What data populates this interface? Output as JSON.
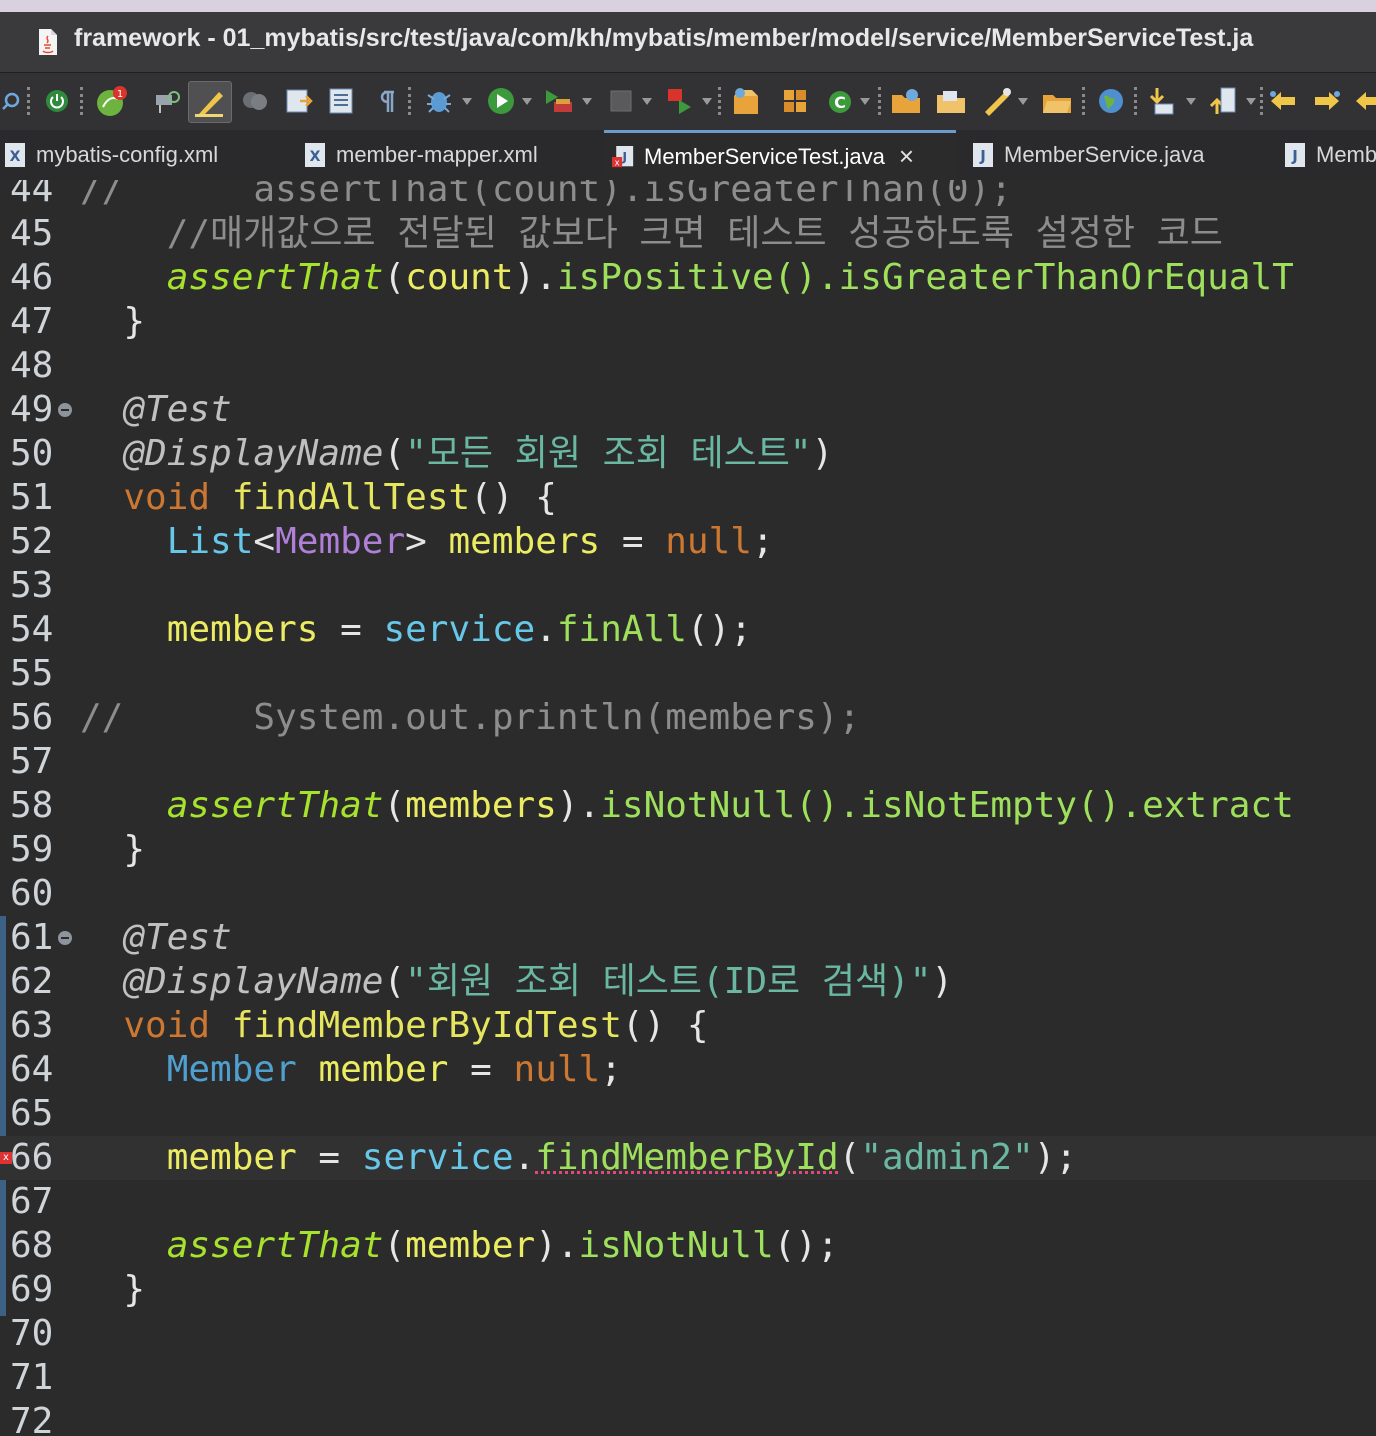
{
  "window": {
    "title": "framework - 01_mybatis/src/test/java/com/kh/mybatis/member/model/service/MemberServiceTest.ja"
  },
  "toolbar": {
    "items": [
      "search-icon",
      "debug-skip-icon",
      "power-icon",
      "spring-icon",
      "pin-icon",
      "highlight-icon",
      "terminal-icon",
      "open-task-icon",
      "open-console-icon",
      "pilcrow-icon",
      "debug-icon",
      "run-icon",
      "coverage-icon",
      "stop-icon",
      "external-tool-icon",
      "new-package-icon",
      "new-class-icon",
      "new-refresh-icon",
      "open-folder-icon",
      "open-project-icon",
      "brush-icon",
      "open-file-icon",
      "globe-icon",
      "next-annotation-icon",
      "prev-annotation-icon",
      "back-icon",
      "forward-icon",
      "back-alt-icon"
    ],
    "spring_badge": "1"
  },
  "tabs": [
    {
      "label": "mybatis-config.xml",
      "icon": "xml-file-icon",
      "active": false
    },
    {
      "label": "member-mapper.xml",
      "icon": "xml-file-icon",
      "active": false
    },
    {
      "label": "MemberServiceTest.java",
      "icon": "java-file-error-icon",
      "active": true,
      "close": "×"
    },
    {
      "label": "MemberService.java",
      "icon": "java-file-icon",
      "active": false
    },
    {
      "label": "Memb",
      "icon": "java-file-icon",
      "active": false
    }
  ],
  "editor": {
    "lines": [
      {
        "n": "44",
        "text": "//       assertThat(count).isGreaterThan(0);"
      },
      {
        "n": "45",
        "text": "        //매개값으로 전달된 값보다 크면 테스트 성공하도록 설정한 코드"
      },
      {
        "n": "46",
        "text": "        assertThat(count).isPositive().isGreaterThanOrEqualT"
      },
      {
        "n": "47",
        "text": "    }"
      },
      {
        "n": "48",
        "text": ""
      },
      {
        "n": "49",
        "text": "    @Test"
      },
      {
        "n": "50",
        "text": "    @DisplayName(\"모든 회원 조회 테스트\")"
      },
      {
        "n": "51",
        "text": "    void findAllTest() {"
      },
      {
        "n": "52",
        "text": "        List<Member> members = null;"
      },
      {
        "n": "53",
        "text": ""
      },
      {
        "n": "54",
        "text": "        members = service.finAll();"
      },
      {
        "n": "55",
        "text": ""
      },
      {
        "n": "56",
        "text": "//       System.out.println(members);"
      },
      {
        "n": "57",
        "text": ""
      },
      {
        "n": "58",
        "text": "        assertThat(members).isNotNull().isNotEmpty().extract"
      },
      {
        "n": "59",
        "text": "    }"
      },
      {
        "n": "60",
        "text": ""
      },
      {
        "n": "61",
        "text": "    @Test"
      },
      {
        "n": "62",
        "text": "    @DisplayName(\"회원 조회 테스트(ID로 검색)\")"
      },
      {
        "n": "63",
        "text": "    void findMemberByIdTest() {"
      },
      {
        "n": "64",
        "text": "        Member member = null;"
      },
      {
        "n": "65",
        "text": ""
      },
      {
        "n": "66",
        "text": "        member = service.findMemberById(\"admin2\");"
      },
      {
        "n": "67",
        "text": ""
      },
      {
        "n": "68",
        "text": "        assertThat(member).isNotNull();"
      },
      {
        "n": "69",
        "text": "    }"
      },
      {
        "n": "70",
        "text": ""
      },
      {
        "n": "71",
        "text": ""
      },
      {
        "n": "72",
        "text": ""
      }
    ],
    "tokens": {
      "l44_cm": "//",
      "l44_code": "assertThat(count).isGreaterThan(0);",
      "l45_cm": "//매개값으로 전달된 값보다 크면 테스트 성공하도록 설정한 코드",
      "l46_assert": "assertThat",
      "l46_count": "count",
      "l46_rest": "isPositive().isGreaterThanOrEqualT",
      "brace_close": "}",
      "ann_test": "@Test",
      "ann_display": "@DisplayName",
      "l50_str": "\"모든 회원 조회 테스트\"",
      "kw_void": "void",
      "l51_fn": "findAllTest",
      "l52_list": "List",
      "l52_member": "Member",
      "l52_var": "members",
      "kw_null": "null",
      "l54_var": "members",
      "l54_service": "service",
      "l54_call": "finAll",
      "l56_cm": "//",
      "l56_code": "System.out.println(members);",
      "l58_assert": "assertThat",
      "l58_arg": "members",
      "l58_rest": "isNotNull().isNotEmpty().extract",
      "l62_str": "\"회원 조회 테스트(ID로 검색)\"",
      "l63_fn": "findMemberByIdTest",
      "l64_type": "Member",
      "l64_var": "member",
      "l66_var": "member",
      "l66_service": "service",
      "l66_call": "findMemberById",
      "l66_str": "\"admin2\"",
      "l68_assert": "assertThat",
      "l68_arg": "member",
      "l68_rest": "isNotNull"
    }
  }
}
